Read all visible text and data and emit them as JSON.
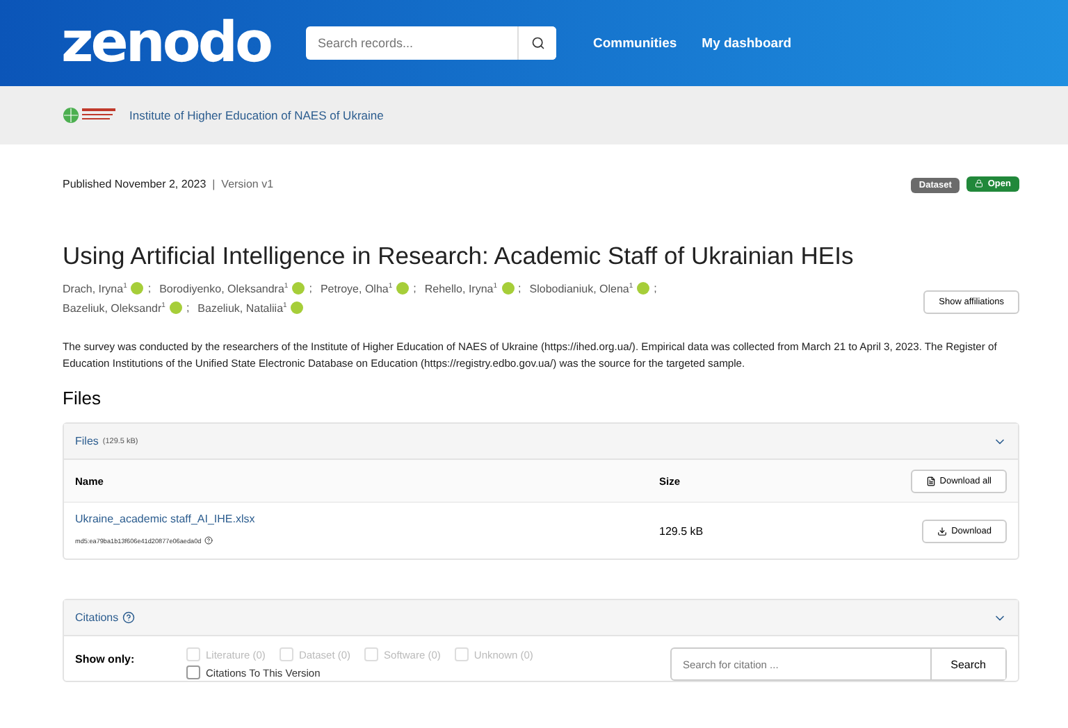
{
  "header": {
    "logo": "zenodo",
    "search": {
      "placeholder": "Search records..."
    },
    "nav": [
      "Communities",
      "My dashboard"
    ]
  },
  "community": {
    "name": "Institute of Higher Education of NAES of Ukraine"
  },
  "record": {
    "published": "Published November 2, 2023",
    "separator": "|",
    "version": "Version v1",
    "badges": [
      {
        "label": "Dataset",
        "kind": "type"
      },
      {
        "label": "Open",
        "kind": "access"
      }
    ],
    "title": "Using Artificial Intelligence in Research: Academic Staff of Ukrainian HEIs",
    "authors": [
      {
        "name": "Drach, Iryna",
        "affiliation": "1",
        "separator": ";"
      },
      {
        "name": "Borodiyenko, Oleksandra",
        "affiliation": "1",
        "separator": ";"
      },
      {
        "name": "Petroye, Olha",
        "affiliation": "1",
        "separator": ";"
      },
      {
        "name": "Rehello, Iryna",
        "affiliation": "1",
        "separator": ";"
      },
      {
        "name": "Slobodianiuk, Olena",
        "affiliation": "1",
        "separator": ";"
      },
      {
        "name": "Bazeliuk, Oleksandr",
        "affiliation": "1",
        "separator": ";"
      },
      {
        "name": "Bazeliuk, Nataliia",
        "affiliation": "1"
      }
    ],
    "affiliations_button": "Show affiliations",
    "description": "The survey was conducted by the researchers of the Institute of Higher Education of NAES of Ukraine (https://ihed.org.ua/). Empirical data was collected from March 21 to April 3, 2023. The Register of Education Institutions of the Unified State Electronic Database on Education (https://registry.edbo.gov.ua/) was the source for the targeted sample."
  },
  "files": {
    "heading": "Files",
    "panel_title": "Files",
    "panel_size": "(129.5 kB)",
    "expanded": true,
    "columns": [
      "Name",
      "Size"
    ],
    "download_all": "Download all",
    "rows": [
      {
        "name": "Ukraine_academic staff_AI_IHE.xlsx",
        "checksum": "md5:ea79ba1b13f606e41d20877e06aeda0d",
        "size": "129.5 kB",
        "button": "Download"
      }
    ]
  },
  "citations": {
    "title": "Citations",
    "expanded": true,
    "show_only": "Show only:",
    "filters": [
      {
        "label": "Literature (0)",
        "checked": false,
        "disabled": true
      },
      {
        "label": "Dataset (0)",
        "checked": false,
        "disabled": true
      },
      {
        "label": "Software (0)",
        "checked": false,
        "disabled": true
      },
      {
        "label": "Unknown (0)",
        "checked": false,
        "disabled": true
      }
    ],
    "version_filter": {
      "label": "Citations To This Version",
      "checked": false,
      "disabled": false
    },
    "search": {
      "placeholder": "Search for citation ...",
      "button": "Search"
    }
  }
}
